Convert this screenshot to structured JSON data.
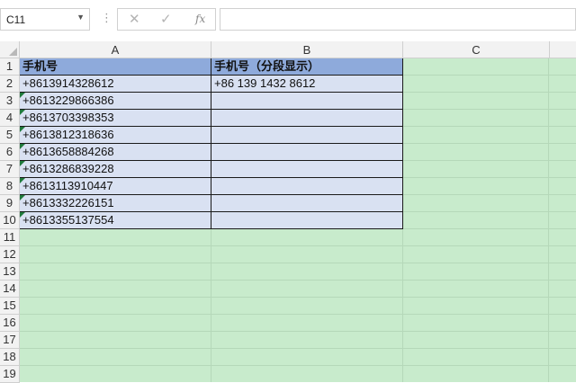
{
  "formula_bar": {
    "name_box": "C11",
    "name_box_arrow": "▼",
    "separator": "⋮",
    "cancel_icon": "✕",
    "enter_icon": "✓",
    "function_label": "fx",
    "formula": ""
  },
  "columns": [
    "A",
    "B",
    "C"
  ],
  "rows": [
    "1",
    "2",
    "3",
    "4",
    "5",
    "6",
    "7",
    "8",
    "9",
    "10",
    "11",
    "12",
    "13",
    "14",
    "15",
    "16",
    "17",
    "18",
    "19"
  ],
  "table": {
    "header": [
      "手机号",
      "手机号（分段显示）"
    ],
    "col_a": [
      "+8613914328612",
      "+8613229866386",
      "+8613703398353",
      "+8613812318636",
      "+8613658884268",
      "+8613286839228",
      "+8613113910447",
      "+8613332226151",
      "+8613355137554"
    ],
    "col_b": [
      "+86 139 1432 8612",
      "",
      "",
      "",
      "",
      "",
      "",
      "",
      ""
    ]
  },
  "colors": {
    "sheet_bg": "#c8ebcc",
    "header_fill": "#8eaadb",
    "data_fill": "#d9e1f2",
    "error_indicator": "#1f7a3c"
  }
}
